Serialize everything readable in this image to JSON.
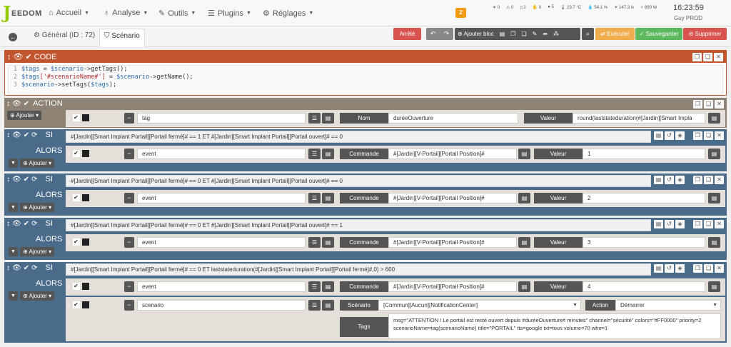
{
  "app": {
    "logo_text": "EEDOM",
    "logo_letter": "J"
  },
  "nav": {
    "items": [
      {
        "label": "Accueil"
      },
      {
        "label": "Analyse"
      },
      {
        "label": "Outils"
      },
      {
        "label": "Plugins"
      },
      {
        "label": "Réglages"
      }
    ],
    "notification_count": "2",
    "status": [
      "0",
      "0",
      "2",
      "0",
      "5",
      "23.7 °C",
      "54.1 %",
      "147.3 lx",
      "690 W"
    ],
    "time": "16:23:59",
    "user": "Guy PROD"
  },
  "tabs": {
    "general": "Général (ID : 72)",
    "scenario": "Scénario"
  },
  "toolbar": {
    "status_label": "Arrêté",
    "add_block": "Ajouter bloc",
    "execute": "Exécuter",
    "save": "Sauvegarder",
    "delete": "Supprimer"
  },
  "code_block": {
    "title": "CODE",
    "lines": [
      {
        "var": "$tags",
        "rest1": " = ",
        "var2": "$scenario",
        "rest2": "->getTags();"
      },
      {
        "var": "$tags",
        "str": "['#scenarioName#']",
        "rest1": " = ",
        "var2": "$scenario",
        "rest2": "->getName();"
      },
      {
        "var": "$scenario",
        "rest1": "->setTags(",
        "var2": "$tags",
        "rest2": ");"
      }
    ]
  },
  "action_block": {
    "title": "ACTION",
    "add_label": "Ajouter",
    "row": {
      "cmd": "tag",
      "name_label": "Nom",
      "name_value": "duréeOuverture",
      "value_label": "Valeur",
      "value": "round(laststateduration(#[Jardin][Smart Impla"
    }
  },
  "si_blocks": [
    {
      "si_label": "SI",
      "alors_label": "ALORS",
      "add_label": "Ajouter",
      "condition": "#[Jardin][Smart Implant Portail][Portail fermé]# == 1 ET #[Jardin][Smart Implant Portail][Portail ouvert]# == 0",
      "row": {
        "cmd": "event",
        "command_label": "Commande",
        "command": "#[Jardin][V-Portail][Portail Position]#",
        "value_label": "Valeur",
        "value": "1"
      }
    },
    {
      "si_label": "SI",
      "alors_label": "ALORS",
      "add_label": "Ajouter",
      "condition": "#[Jardin][Smart Implant Portail][Portail fermé]# == 0 ET #[Jardin][Smart Implant Portail][Portail ouvert]# == 0",
      "row": {
        "cmd": "event",
        "command_label": "Commande",
        "command": "#[Jardin][V-Portail][Portail Position]#",
        "value_label": "Valeur",
        "value": "2"
      }
    },
    {
      "si_label": "SI",
      "alors_label": "ALORS",
      "add_label": "Ajouter",
      "condition": "#[Jardin][Smart Implant Portail][Portail fermé]# == 0 ET #[Jardin][Smart Implant Portail][Portail ouvert]# == 1",
      "row": {
        "cmd": "event",
        "command_label": "Commande",
        "command": "#[Jardin][V-Portail][Portail Position]#",
        "value_label": "Valeur",
        "value": "3"
      }
    },
    {
      "si_label": "SI",
      "alors_label": "ALORS",
      "add_label": "Ajouter",
      "condition": "#[Jardin][Smart Implant Portail][Portail fermé]# == 0 ET laststateduration(#[Jardin][Smart Implant Portail][Portail fermé]#,0) > 600",
      "row": {
        "cmd": "event",
        "command_label": "Commande",
        "command": "#[Jardin][V-Portail][Portail Position]#",
        "value_label": "Valeur",
        "value": "4"
      },
      "row2": {
        "cmd": "scenario",
        "scenario_label": "Scénario",
        "scenario": "[Commun][Aucun][NotificationCenter]",
        "action_label": "Action",
        "action": "Démarrer",
        "tags_label": "Tags",
        "tags": "msg=\"ATTENTION ! Le portail est resté ouvert depuis #duréeOuverture# minutes\" channel=\"sécurité\" colors=\"#FF0000\" priority=2 scenarioName=tag(scenarioName) title=\"PORTAIL\" tts=google txt=tous volume=70 who=1"
      }
    }
  ]
}
